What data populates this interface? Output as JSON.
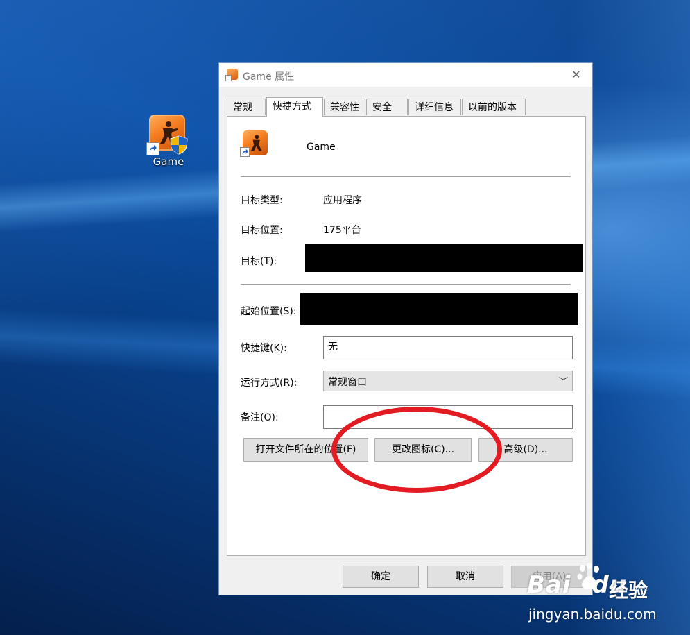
{
  "desktop": {
    "icon_label": "Game"
  },
  "window": {
    "title": "Game 属性",
    "close_glyph": "✕",
    "tabs": [
      {
        "label": "常规",
        "active": false
      },
      {
        "label": "快捷方式",
        "active": true
      },
      {
        "label": "兼容性",
        "active": false
      },
      {
        "label": "安全",
        "active": false
      },
      {
        "label": "详细信息",
        "active": false
      },
      {
        "label": "以前的版本",
        "active": false
      }
    ],
    "shortcut": {
      "name": "Game",
      "target_type_label": "目标类型:",
      "target_type_value": "应用程序",
      "target_location_label": "目标位置:",
      "target_location_value": "175平台",
      "target_label": "目标(T):",
      "start_in_label": "起始位置(S):",
      "hotkey_label": "快捷键(K):",
      "hotkey_value": "无",
      "run_label": "运行方式(R):",
      "run_value": "常规窗口",
      "comment_label": "备注(O):",
      "comment_value": ""
    },
    "buttons": {
      "open_location": "打开文件所在的位置(F)",
      "change_icon": "更改图标(C)...",
      "advanced": "高级(D)..."
    },
    "footer": {
      "ok": "确定",
      "cancel": "取消",
      "apply": "应用(A)"
    }
  },
  "watermark": {
    "brand": "Bai",
    "brand2": "du",
    "product": "经验",
    "url": "jingyan.baidu.com"
  },
  "colors": {
    "annotation_circle": "#e31b23",
    "desktop_blue": "#0a4fa4",
    "icon_orange": "#f47b1e"
  }
}
